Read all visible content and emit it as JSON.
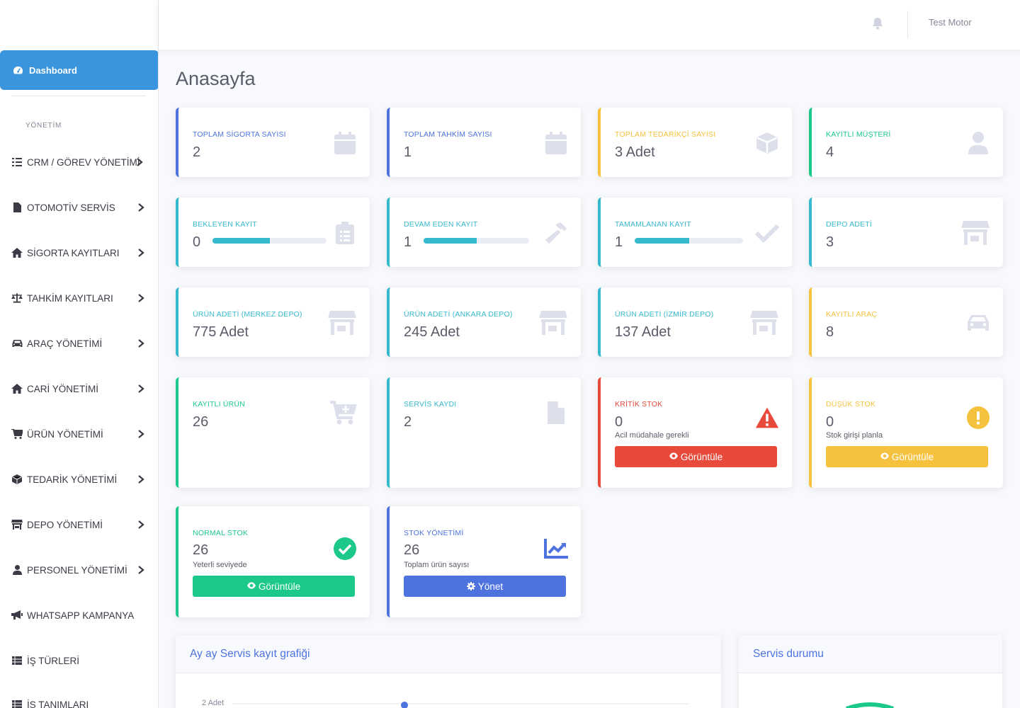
{
  "topbar": {
    "user_name": "Test Motor"
  },
  "sidebar": {
    "dashboard_label": "Dashboard",
    "section_heading": "YÖNETİM",
    "items": [
      {
        "label": "CRM / GÖREV YÖNETİMİ",
        "icon": "tasks-icon"
      },
      {
        "label": "OTOMOTİV SERVİS",
        "icon": "file-icon"
      },
      {
        "label": "SİGORTA KAYITLARI",
        "icon": "home-icon"
      },
      {
        "label": "TAHKİM KAYITLARI",
        "icon": "scale-icon"
      },
      {
        "label": "ARAÇ YÖNETİMİ",
        "icon": "car-icon"
      },
      {
        "label": "CARİ YÖNETİMİ",
        "icon": "home-icon"
      },
      {
        "label": "ÜRÜN YÖNETİMİ",
        "icon": "cart-icon"
      },
      {
        "label": "TEDARİK YÖNETİMİ",
        "icon": "box-icon"
      },
      {
        "label": "DEPO YÖNETİMİ",
        "icon": "warehouse-icon"
      },
      {
        "label": "PERSONEL YÖNETİMİ",
        "icon": "user-icon"
      },
      {
        "label": "WHATSAPP KAMPANYA",
        "icon": "bullhorn-icon"
      },
      {
        "label": "İŞ TÜRLERİ",
        "icon": "table-icon"
      },
      {
        "label": "İŞ TANIMLARI",
        "icon": "table-icon"
      }
    ]
  },
  "page_title": "Anasayfa",
  "cards": {
    "sigorta": {
      "title": "TOPLAM SİGORTA SAYISI",
      "value": "2"
    },
    "tahkim": {
      "title": "TOPLAM TAHKİM SAYISI",
      "value": "1"
    },
    "tedarikci": {
      "title": "TOPLAM TEDARİKÇİ SAYISI",
      "value": "3 Adet"
    },
    "musteri": {
      "title": "KAYITLI MÜŞTERİ",
      "value": "4"
    },
    "bekleyen": {
      "title": "BEKLEYEN KAYIT",
      "value": "0",
      "progress_percent": 50
    },
    "devam": {
      "title": "DEVAM EDEN KAYIT",
      "value": "1",
      "progress_percent": 50
    },
    "tamamlanan": {
      "title": "TAMAMLANAN KAYIT",
      "value": "1",
      "progress_percent": 50
    },
    "depo": {
      "title": "DEPO ADETİ",
      "value": "3"
    },
    "merkez": {
      "title": "ÜRÜN ADETİ (MERKEZ DEPO)",
      "value": "775 Adet"
    },
    "ankara": {
      "title": "ÜRÜN ADETİ (ANKARA DEPO)",
      "value": "245 Adet"
    },
    "izmir": {
      "title": "ÜRÜN ADETİ (İZMİR DEPO)",
      "value": "137 Adet"
    },
    "arac": {
      "title": "KAYITLI ARAÇ",
      "value": "8"
    },
    "urun": {
      "title": "KAYITLI ÜRÜN",
      "value": "26"
    },
    "servis": {
      "title": "SERVİS KAYDI",
      "value": "2"
    },
    "kritik": {
      "title": "KRİTİK STOK",
      "value": "0",
      "subtitle": "Acil müdahale gerekli",
      "button": "Görüntüle"
    },
    "dusuk": {
      "title": "DÜŞÜK STOK",
      "value": "0",
      "subtitle": "Stok girişi planla",
      "button": "Görüntüle"
    },
    "normal": {
      "title": "NORMAL STOK",
      "value": "26",
      "subtitle": "Yeterli seviyede",
      "button": "Görüntüle"
    },
    "stok": {
      "title": "STOK YÖNETİMİ",
      "value": "26",
      "subtitle": "Toplam ürün sayısı",
      "button": "Yönet"
    }
  },
  "panels": {
    "chart_title": "Ay ay Servis kayıt grafiği",
    "chart_axis_label": "2 Adet",
    "status_title": "Servis durumu"
  },
  "colors": {
    "primary": "#4e73df",
    "warning": "#f6c23e",
    "success": "#1cc88a",
    "info": "#36b9cc",
    "danger": "#e74a3b",
    "sidebar_active": "#3b95de"
  }
}
